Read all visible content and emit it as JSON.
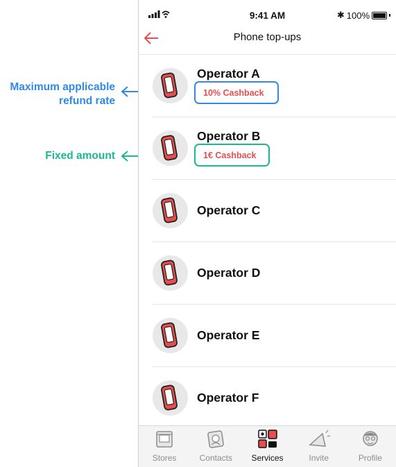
{
  "annotations": {
    "max_rate_line1": "Maximum applicable",
    "max_rate_line2": "refund rate",
    "fixed_amount": "Fixed amount"
  },
  "status_bar": {
    "time": "9:41 AM",
    "battery": "100%"
  },
  "header": {
    "title": "Phone top-ups"
  },
  "operators": [
    {
      "name": "Operator A",
      "cashback": "10% Cashback"
    },
    {
      "name": "Operator B",
      "cashback": "1€ Cashback"
    },
    {
      "name": "Operator C"
    },
    {
      "name": "Operator D"
    },
    {
      "name": "Operator E"
    },
    {
      "name": "Operator F"
    }
  ],
  "tabs": [
    {
      "label": "Stores",
      "icon": "store-icon"
    },
    {
      "label": "Contacts",
      "icon": "contacts-icon"
    },
    {
      "label": "Services",
      "icon": "services-icon",
      "active": true
    },
    {
      "label": "Invite",
      "icon": "megaphone-icon"
    },
    {
      "label": "Profile",
      "icon": "profile-icon"
    }
  ],
  "colors": {
    "accent_red": "#e84d4d",
    "annotation_blue": "#2f8be6",
    "annotation_green": "#1bb894"
  }
}
